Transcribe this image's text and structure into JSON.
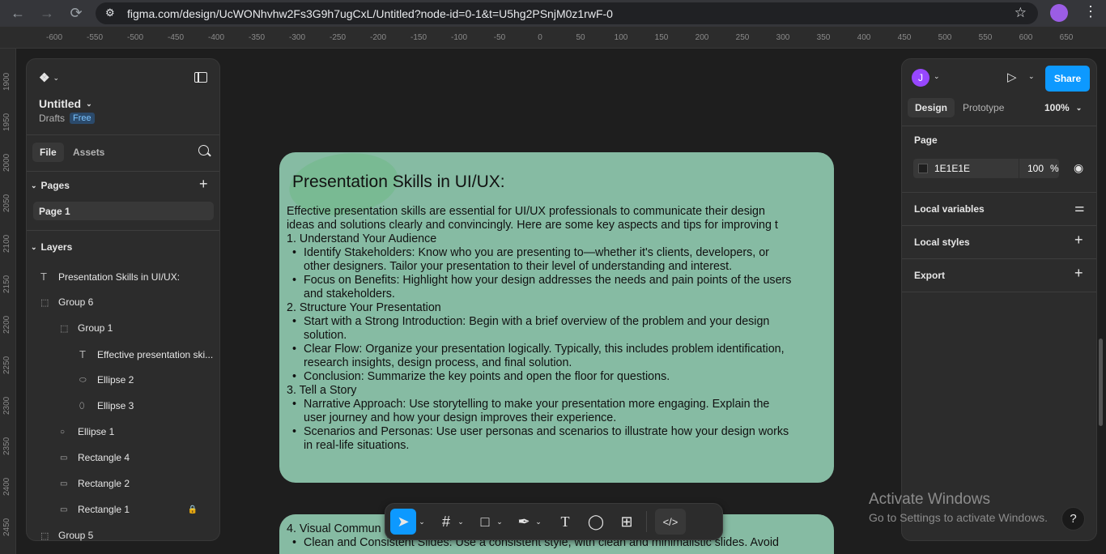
{
  "browser": {
    "url": "figma.com/design/UcWONhvhw2Fs3G9h7ugCxL/Untitled?node-id=0-1&t=U5hg2PSnjM0z1rwF-0"
  },
  "ruler": {
    "top_ticks": [
      "-600",
      "-550",
      "-500",
      "-450",
      "-400",
      "-350",
      "-300",
      "-250",
      "-200",
      "-150",
      "-100",
      "-50",
      "0",
      "50",
      "100",
      "150",
      "200",
      "250",
      "300",
      "350",
      "400",
      "450",
      "500",
      "550",
      "600",
      "650"
    ],
    "left_ticks": [
      "1900",
      "1950",
      "2000",
      "2050",
      "2100",
      "2150",
      "2200",
      "2250",
      "2300",
      "2350",
      "2400",
      "2450"
    ]
  },
  "left_panel": {
    "file_name": "Untitled",
    "location": "Drafts",
    "plan_badge": "Free",
    "tabs": {
      "file": "File",
      "assets": "Assets"
    },
    "pages_header": "Pages",
    "pages": [
      "Page 1"
    ],
    "layers_header": "Layers",
    "layers": [
      {
        "name": "Presentation Skills in UI/UX:",
        "icon": "text-icon"
      },
      {
        "name": "Group 6",
        "icon": "group-icon"
      },
      {
        "name": "Group 1",
        "icon": "group-icon"
      },
      {
        "name": "Effective presentation ski...",
        "icon": "text-icon"
      },
      {
        "name": "Ellipse 2",
        "icon": "ellipse-icon"
      },
      {
        "name": "Ellipse 3",
        "icon": "ellipse-icon"
      },
      {
        "name": "Ellipse 1",
        "icon": "ellipse-icon"
      },
      {
        "name": "Rectangle 4",
        "icon": "rectangle-icon"
      },
      {
        "name": "Rectangle 2",
        "icon": "rectangle-icon"
      },
      {
        "name": "Rectangle 1",
        "icon": "rectangle-icon",
        "locked": true
      },
      {
        "name": "Group 5",
        "icon": "group-icon"
      }
    ]
  },
  "right_panel": {
    "avatar_letter": "J",
    "share_label": "Share",
    "tabs": {
      "design": "Design",
      "prototype": "Prototype"
    },
    "zoom": "100%",
    "page_section": "Page",
    "page_color": "1E1E1E",
    "page_opacity": "100",
    "percent": "%",
    "local_variables": "Local variables",
    "local_styles": "Local styles",
    "export": "Export"
  },
  "canvas": {
    "frame1": {
      "title": "Presentation Skills in UI/UX:",
      "intro1": "Effective presentation skills are essential for UI/UX professionals to communicate their design",
      "intro2": "ideas and solutions clearly and convincingly. Here are some key aspects and tips for improving t",
      "s1": "1. Understand Your Audience",
      "s1b1a": "Identify Stakeholders: Know who you are presenting to—whether it's clients, developers, or",
      "s1b1b": "other designers. Tailor your presentation to their level of understanding and interest.",
      "s1b2a": "Focus on Benefits: Highlight how your design addresses the needs and pain points of the users",
      "s1b2b": "and stakeholders.",
      "s2": "2. Structure Your Presentation",
      "s2b1a": "Start with a Strong Introduction: Begin with a brief overview of the problem and your design",
      "s2b1b": "solution.",
      "s2b2a": "Clear Flow: Organize your presentation logically. Typically, this includes problem identification,",
      "s2b2b": "research insights, design process, and final solution.",
      "s2b3": "Conclusion: Summarize the key points and open the floor for questions.",
      "s3": "3. Tell a Story",
      "s3b1a": "Narrative Approach: Use storytelling to make your presentation more engaging. Explain the",
      "s3b1b": "user journey and how your design improves their experience.",
      "s3b2a": "Scenarios and Personas: Use user personas and scenarios to illustrate how your design works",
      "s3b2b": "in real-life situations."
    },
    "frame2": {
      "s4": "4. Visual Commun",
      "s4b1": "Clean and Consistent Slides: Use a consistent style, with clean and minimalistic slides. Avoid"
    }
  },
  "watermark": {
    "line1": "Activate Windows",
    "line2": "Go to Settings to activate Windows."
  },
  "help": "?",
  "colors": {
    "accent": "#0d99ff",
    "frame": "#86bba3",
    "avatar": "#9747ff"
  }
}
